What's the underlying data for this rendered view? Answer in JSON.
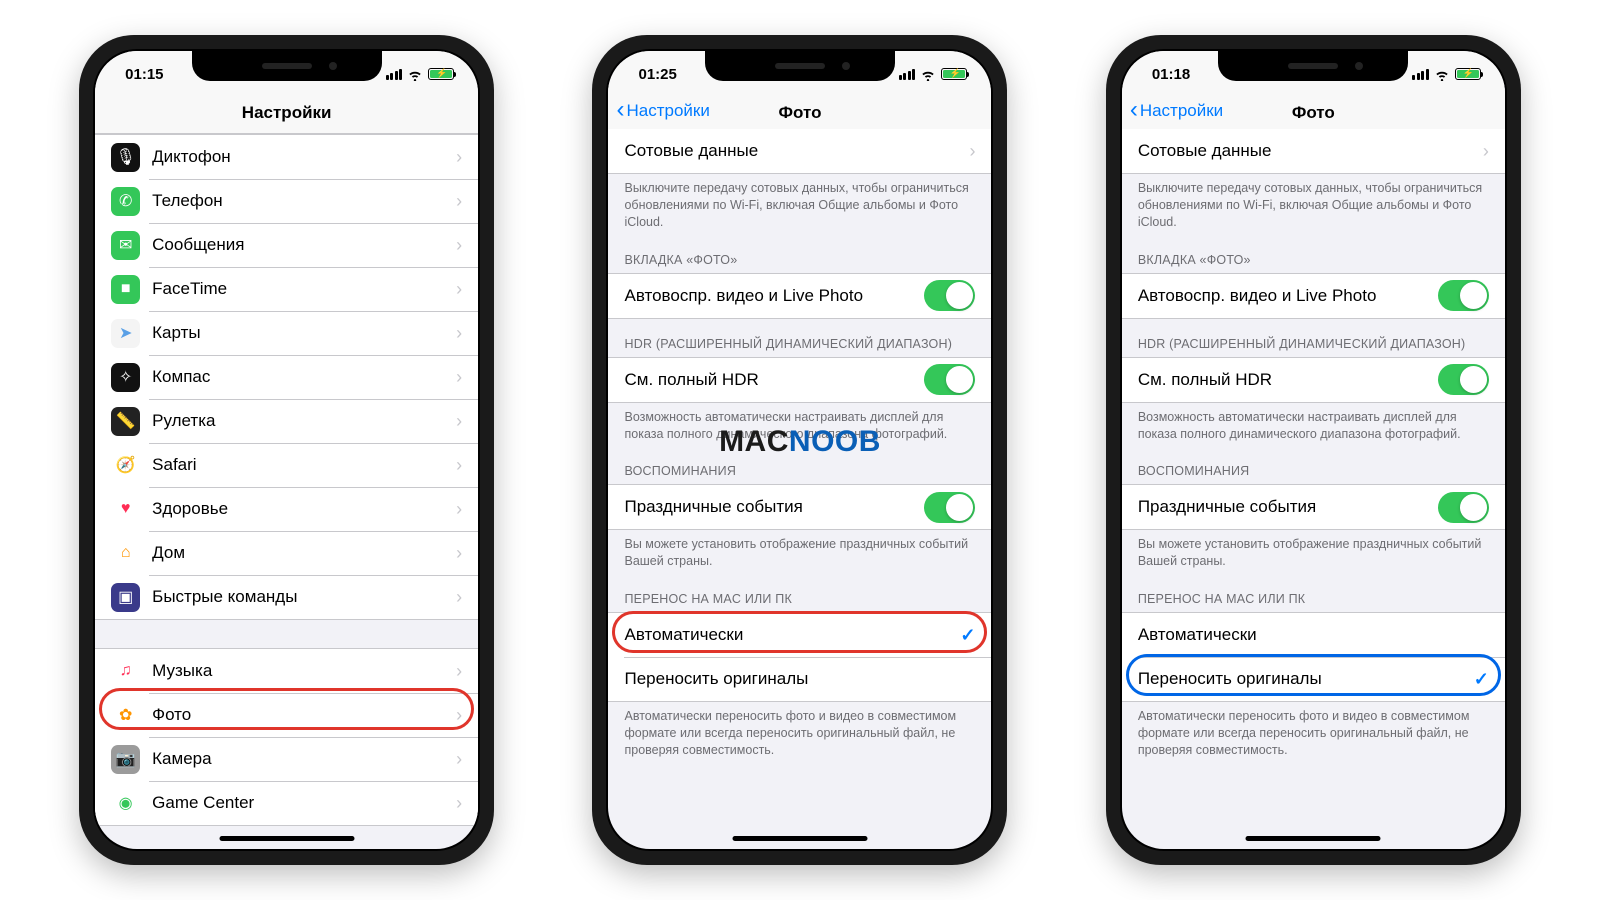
{
  "watermark": {
    "part1": "MAC",
    "part2": "NOOB"
  },
  "phone1": {
    "time": "01:15",
    "title": "Настройки",
    "rows": [
      {
        "label": "Диктофон",
        "icon": "🎙",
        "bg": "#111"
      },
      {
        "label": "Телефон",
        "icon": "✆",
        "bg": "#34c759"
      },
      {
        "label": "Сообщения",
        "icon": "✉︎",
        "bg": "#34c759"
      },
      {
        "label": "FaceTime",
        "icon": "■",
        "bg": "#34c759"
      },
      {
        "label": "Карты",
        "icon": "➤",
        "bg": "#f4f4f4",
        "fc": "#5aa0e6"
      },
      {
        "label": "Компас",
        "icon": "✧",
        "bg": "#111"
      },
      {
        "label": "Рулетка",
        "icon": "📏",
        "bg": "#222"
      },
      {
        "label": "Safari",
        "icon": "🧭",
        "bg": "#fff"
      },
      {
        "label": "Здоровье",
        "icon": "♥",
        "bg": "#fff",
        "fc": "#ff2d55"
      },
      {
        "label": "Дом",
        "icon": "⌂",
        "bg": "#fff",
        "fc": "#ff9500"
      },
      {
        "label": "Быстрые команды",
        "icon": "▣",
        "bg": "#3a3a8a"
      }
    ],
    "rows2": [
      {
        "label": "Музыка",
        "icon": "♫",
        "bg": "#fff",
        "fc": "#ff2d55"
      },
      {
        "label": "Фото",
        "icon": "✿",
        "bg": "#fff",
        "fc": "#ff9500"
      },
      {
        "label": "Камера",
        "icon": "📷",
        "bg": "#9b9b9b"
      },
      {
        "label": "Game Center",
        "icon": "◉",
        "bg": "#fff",
        "fc": "#34c759"
      }
    ]
  },
  "phone2": {
    "time": "01:25",
    "back": "Настройки",
    "title": "Фото",
    "cellular_row": "Сотовые данные",
    "cellular_foot": "Выключите передачу сотовых данных, чтобы ограничиться обновлениями по Wi-Fi, включая Общие альбомы и Фото iCloud.",
    "section_photo": "ВКЛАДКА «ФОТО»",
    "autoplay": "Автовоспр. видео и Live Photo",
    "section_hdr": "HDR (РАСШИРЕННЫЙ ДИНАМИЧЕСКИЙ ДИАПАЗОН)",
    "hdr_row": "См. полный HDR",
    "hdr_foot": "Возможность автоматически настраивать дисплей для показа полного динамического диапазона фотографий.",
    "section_mem": "ВОСПОМИНАНИЯ",
    "holidays": "Праздничные события",
    "mem_foot": "Вы можете установить отображение праздничных событий Вашей страны.",
    "section_transfer": "ПЕРЕНОС НА MAC ИЛИ ПК",
    "opt_auto": "Автоматически",
    "opt_orig": "Переносить оригиналы",
    "transfer_foot": "Автоматически переносить фото и видео в совместимом формате или всегда переносить оригинальный файл, не проверяя совместимость."
  },
  "phone3": {
    "time": "01:18",
    "back": "Настройки",
    "title": "Фото"
  }
}
